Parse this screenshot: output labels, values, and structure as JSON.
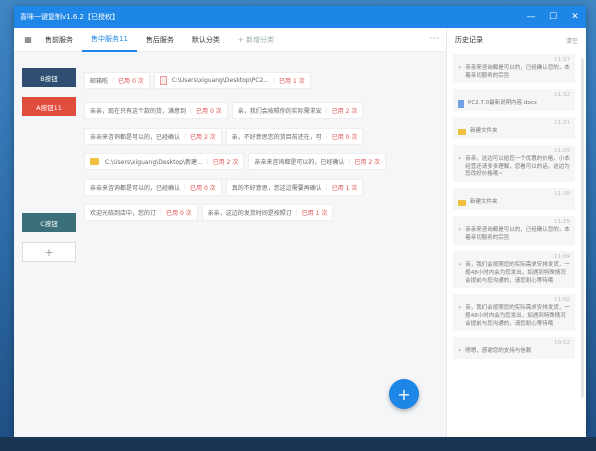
{
  "window": {
    "title": "喜咪一键复制v1.6.2【已授权】"
  },
  "tabs": [
    {
      "label": "售前服务"
    },
    {
      "label": "售中服务11"
    },
    {
      "label": "售后服务"
    },
    {
      "label": "默认分类"
    },
    {
      "label": "+ 新增分类"
    }
  ],
  "more_label": "···",
  "sidebar": {
    "b1": "B按钮",
    "a1": "A按钮11",
    "c1": "C按钮",
    "add": "+"
  },
  "chips": {
    "r1": [
      {
        "text": "邮箱啦",
        "use": "已用 0 次"
      },
      {
        "text": "C:\\Users\\xiguang\\Desktop\\PC2...",
        "use": "已用 1 次",
        "icon": "file-icon"
      }
    ],
    "r2": [
      {
        "text": "亲亲，现在只有这个款的货，满意到",
        "use": "已用 0 次"
      },
      {
        "text": "亲，我们会按照你的实际需求安",
        "use": "已用 2 次"
      }
    ],
    "r3": [
      {
        "text": "亲亲来咨询都是可以的，已经确认",
        "use": "已用 2 次"
      },
      {
        "text": "亲，不好意思您的货目前还在，可",
        "use": "已用 0 次"
      }
    ],
    "r4": [
      {
        "text": "C:\\Users\\xiguang\\Desktop\\新建...",
        "use": "已用 2 次",
        "icon": "folder-icon"
      },
      {
        "text": "亲亲来咨询都是可以的，已经确认",
        "use": "已用 2 次"
      }
    ],
    "r5": [
      {
        "text": "亲亲来咨询都是可以的，已经确认",
        "use": "已用 0 次"
      },
      {
        "text": "真的不好意思，您这边需要再确认",
        "use": "已用 1 次"
      }
    ],
    "r6": [
      {
        "text": "欢迎光临到店中，您的订",
        "use": "已用 0 次"
      },
      {
        "text": "亲亲，这边的发货时间是按照订",
        "use": "已用 1 次"
      }
    ]
  },
  "fab": "+",
  "history": {
    "title": "历史记录",
    "clear": "清空",
    "items": [
      {
        "time": "11:37",
        "text": "亲亲来咨询都是可以的，已经确认您的，本着亲切服务的宗旨",
        "icon": "dot"
      },
      {
        "time": "11:32",
        "text": "PC2.7.0最新说明内容.docx",
        "icon": "doc-icon"
      },
      {
        "time": "11:31",
        "text": "新建文件夹",
        "icon": "fold-icon"
      },
      {
        "time": "11:29",
        "text": "亲亲，这边可以给您一个优惠的价格，小本经营还请多多理解，您看可以的话，这边为您改好价格哦~",
        "icon": "dot"
      },
      {
        "time": "11:28",
        "text": "新建文件夹",
        "icon": "fold-icon"
      },
      {
        "time": "11:25",
        "text": "亲亲来咨询都是可以的，已经确认您的，本着亲切服务的宗旨",
        "icon": "dot"
      },
      {
        "time": "11:09",
        "text": "亲，我们会按照您的实际需求安排发货，一般48小时内会为您发出，如遇到特殊情况会提前与您沟通的，请您耐心等待哦",
        "icon": "dot"
      },
      {
        "time": "11:02",
        "text": "亲，我们会按照您的实际需求安排发货，一般48小时内会为您发出，如遇到特殊情况会提前与您沟通的，请您耐心等待哦",
        "icon": "dot"
      },
      {
        "time": "10:52",
        "text": "嗯嗯，感谢您的支持与信赖",
        "icon": "dot"
      }
    ]
  }
}
